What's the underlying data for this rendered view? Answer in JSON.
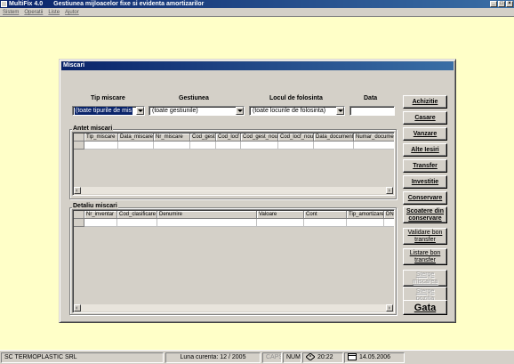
{
  "titlebar": {
    "app": "MultiFix 4.0",
    "subtitle": "Gestiunea mijloacelor fixe si evidenta amortizarilor",
    "controls": [
      "_",
      "□",
      "×"
    ]
  },
  "menu": [
    "Sistem",
    "Operatii",
    "Liste",
    "Ajutor"
  ],
  "window": {
    "title": "Miscari",
    "filters": {
      "tip_label": "Tip miscare",
      "tip_value": "(toate tipurile de mis",
      "gestiunea_label": "Gestiunea",
      "gestiunea_value": "(toate gestiunile)",
      "loc_label": "Locul de folosinta",
      "loc_value": "(toate locurile de folosinta)",
      "data_label": "Data",
      "data_value": ""
    },
    "antet": {
      "label": "Antet miscari",
      "columns": [
        "Tip_miscare",
        "Data_miscare",
        "Nr_miscare",
        "Cod_gest",
        "Cod_locf",
        "Cod_gest_noua",
        "Cod_locf_noua",
        "Data_document",
        "Numar_document"
      ]
    },
    "detaliu": {
      "label": "Detaliu miscari",
      "columns": [
        "Nr_inventar",
        "Cod_clasificare",
        "Denumire",
        "Valoare",
        "Cont",
        "Tip_amortizare",
        "DN"
      ]
    },
    "buttons": {
      "achizitie": "Achizitie",
      "casare": "Casare",
      "vanzare": "Vanzare",
      "alte_iesiri": "Alte Iesiri",
      "transfer": "Transfer",
      "investitie": "Investitie",
      "conservare": "Conservare",
      "scoatere": "Scoatere din\nconservare",
      "validare": "Validare bon\ntransfer",
      "listare": "Listare bon\ntransfer",
      "sterge_miscarea": "Sterge\nmiscarea",
      "sterge_pozitia": "Sterge\npozitia",
      "gata": "Gata"
    }
  },
  "status": {
    "company": "SC TERMOPLASTIC SRL",
    "luna": "Luna curenta: 12 / 2005",
    "caps": "CAPS",
    "num": "NUM",
    "time": "20:22",
    "date": "14.05.2006"
  }
}
